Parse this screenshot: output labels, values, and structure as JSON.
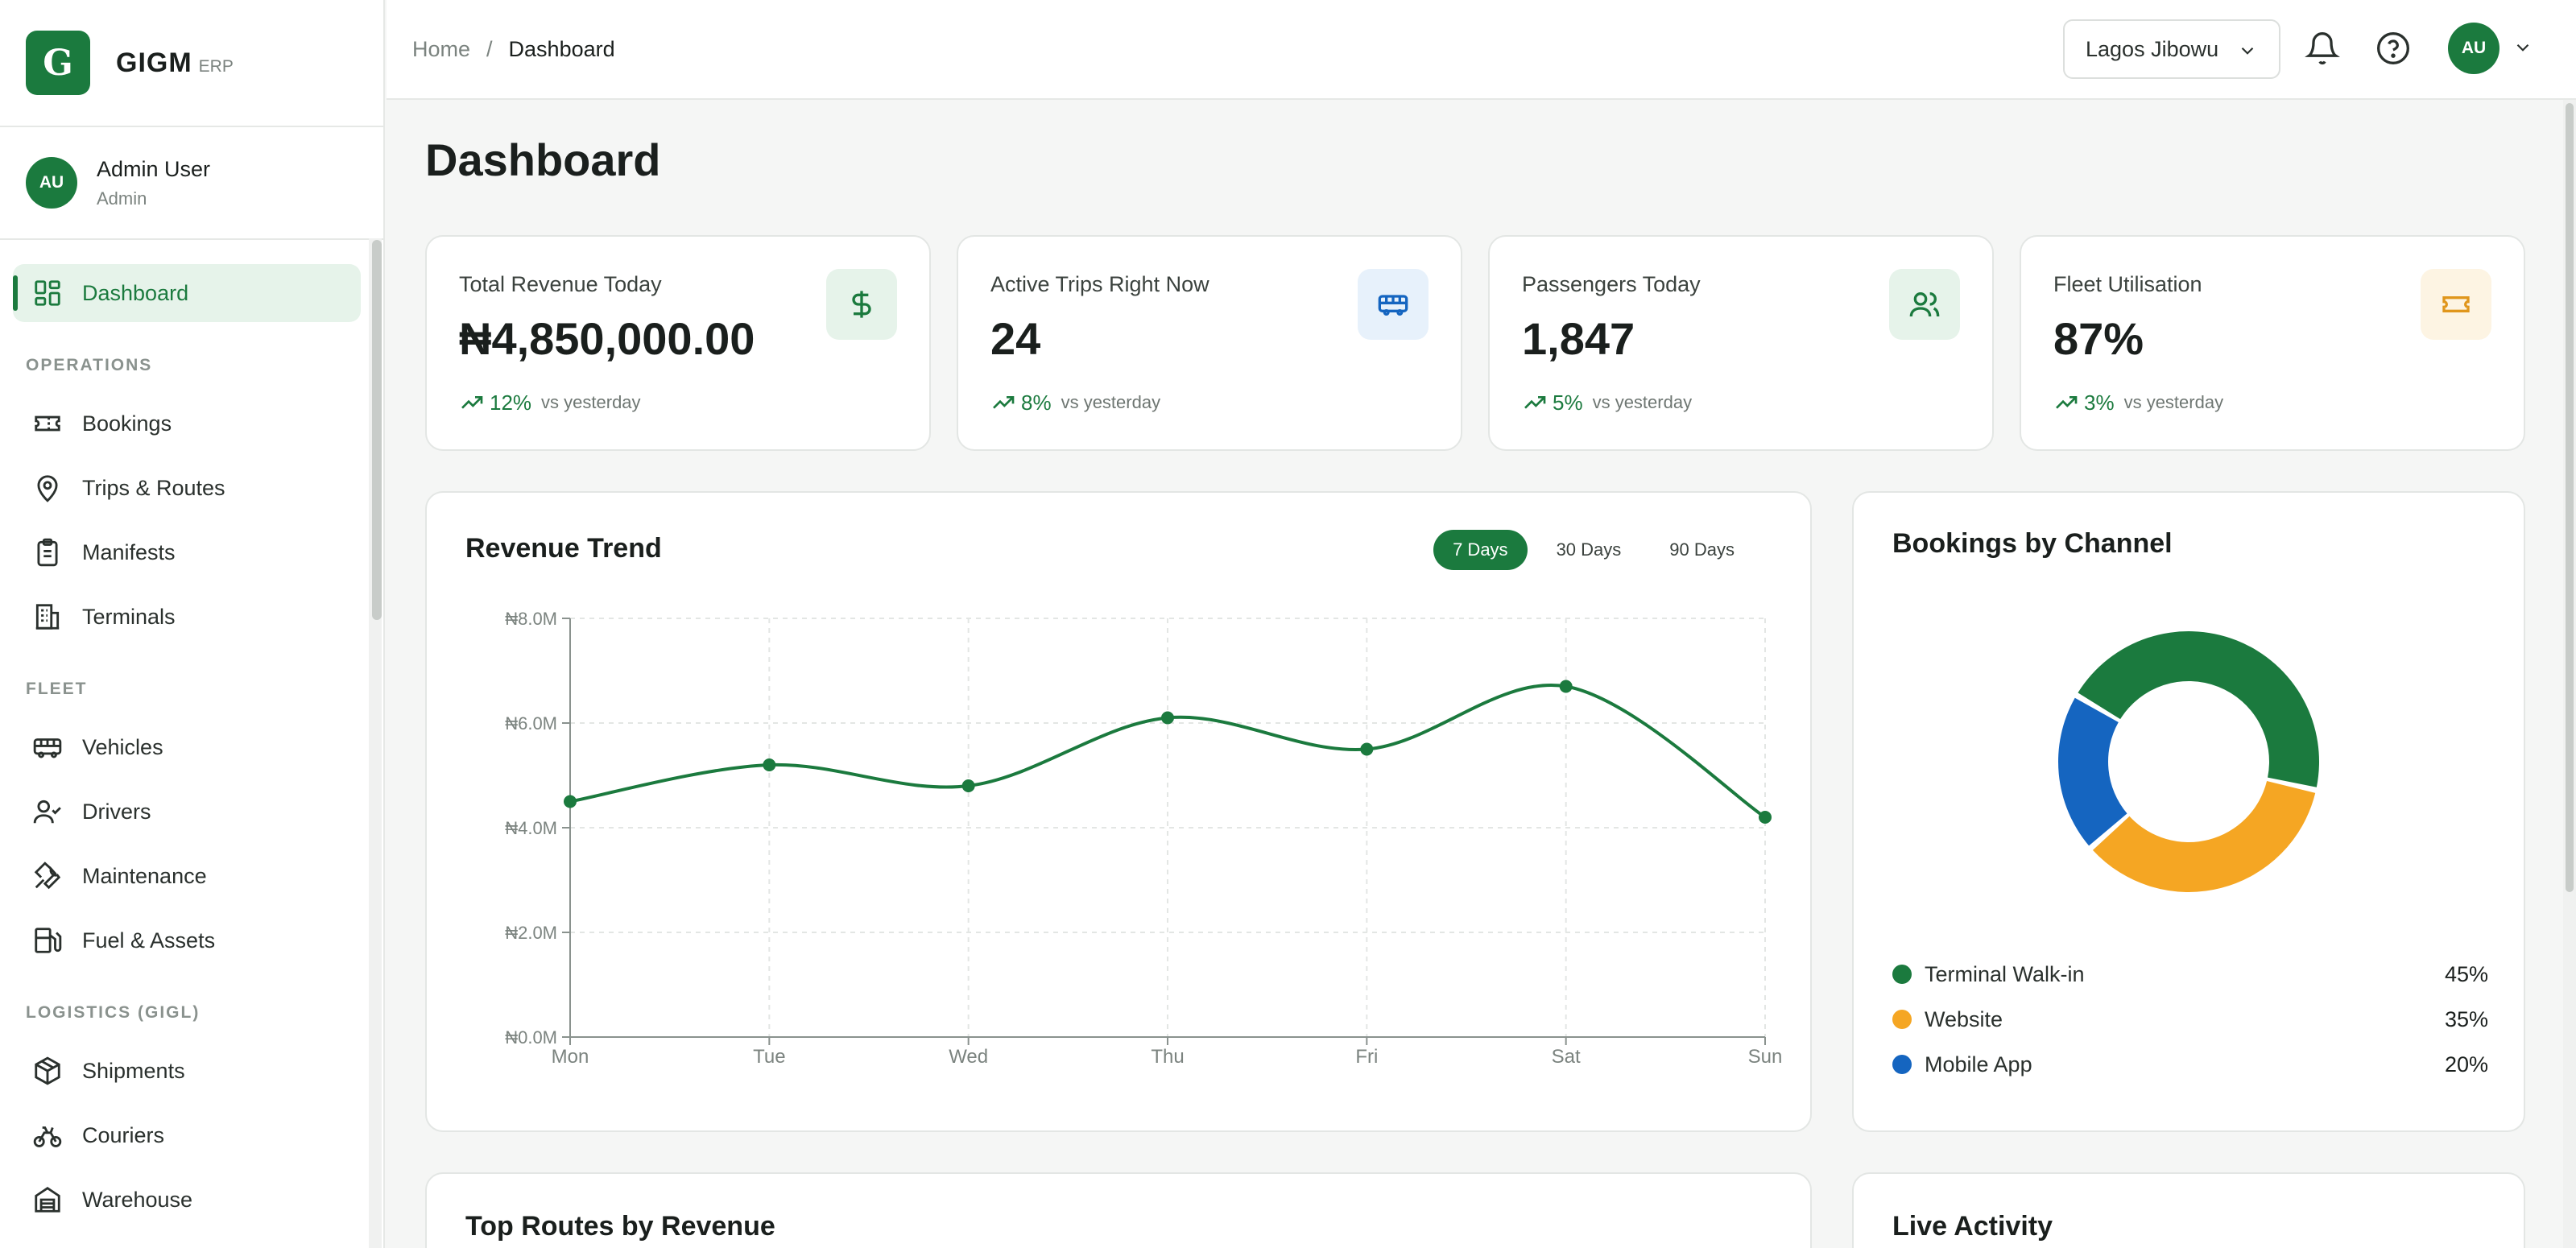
{
  "brand": {
    "logo_letter": "G",
    "name": "GIGM",
    "sub": "ERP"
  },
  "user": {
    "initials": "AU",
    "name": "Admin User",
    "role": "Admin"
  },
  "sidebar": {
    "dashboard": "Dashboard",
    "section_operations": "OPERATIONS",
    "bookings": "Bookings",
    "trips": "Trips & Routes",
    "manifests": "Manifests",
    "terminals": "Terminals",
    "section_fleet": "FLEET",
    "vehicles": "Vehicles",
    "drivers": "Drivers",
    "maintenance": "Maintenance",
    "fuel": "Fuel & Assets",
    "section_logistics": "LOGISTICS (GIGL)",
    "shipments": "Shipments",
    "couriers": "Couriers",
    "warehouse": "Warehouse"
  },
  "header": {
    "breadcrumb_home": "Home",
    "breadcrumb_sep": "/",
    "breadcrumb_current": "Dashboard",
    "terminal": "Lagos Jibowu",
    "avatar_initials": "AU"
  },
  "page": {
    "title": "Dashboard"
  },
  "stats": [
    {
      "label": "Total Revenue Today",
      "value": "₦4,850,000.00",
      "delta": "12%",
      "vs": "vs yesterday",
      "icon": "dollar-icon",
      "icon_bg": "#e6f3ea",
      "icon_color": "#1b7a3e"
    },
    {
      "label": "Active Trips Right Now",
      "value": "24",
      "delta": "8%",
      "vs": "vs yesterday",
      "icon": "bus-icon",
      "icon_bg": "#e7f1fb",
      "icon_color": "#1565c0"
    },
    {
      "label": "Passengers Today",
      "value": "1,847",
      "delta": "5%",
      "vs": "vs yesterday",
      "icon": "users-icon",
      "icon_bg": "#e6f3ea",
      "icon_color": "#1b7a3e"
    },
    {
      "label": "Fleet Utilisation",
      "value": "87%",
      "delta": "3%",
      "vs": "vs yesterday",
      "icon": "ticket-icon",
      "icon_bg": "#fdf4e3",
      "icon_color": "#e0961c"
    }
  ],
  "revenue": {
    "title": "Revenue Trend",
    "ranges": [
      "7 Days",
      "30 Days",
      "90 Days"
    ],
    "active_range": "7 Days"
  },
  "channels": {
    "title": "Bookings by Channel"
  },
  "bottom": {
    "routes_title": "Top Routes by Revenue",
    "activity_title": "Live Activity"
  },
  "colors": {
    "primary": "#1b7a3e",
    "orange": "#f5a623",
    "blue": "#1565c0"
  },
  "chart_data": [
    {
      "type": "line",
      "title": "Revenue Trend",
      "categories": [
        "Mon",
        "Tue",
        "Wed",
        "Thu",
        "Fri",
        "Sat",
        "Sun"
      ],
      "series": [
        {
          "values": [
            4.5,
            5.2,
            4.8,
            6.1,
            5.5,
            6.7,
            4.2
          ],
          "color": "#1b7a3e"
        }
      ],
      "ylim": [
        0,
        8
      ],
      "yticks": [
        "₦0.0M",
        "₦2.0M",
        "₦4.0M",
        "₦6.0M",
        "₦8.0M"
      ],
      "ytick_values": [
        0,
        2,
        4,
        6,
        8
      ],
      "grid": true
    },
    {
      "type": "pie",
      "title": "Bookings by Channel",
      "labels": [
        "Terminal Walk-in",
        "Website",
        "Mobile App"
      ],
      "values": [
        45,
        35,
        20
      ],
      "value_labels": [
        "45%",
        "35%",
        "20%"
      ],
      "colors": [
        "#1b7a3e",
        "#f5a623",
        "#1565c0"
      ]
    }
  ]
}
